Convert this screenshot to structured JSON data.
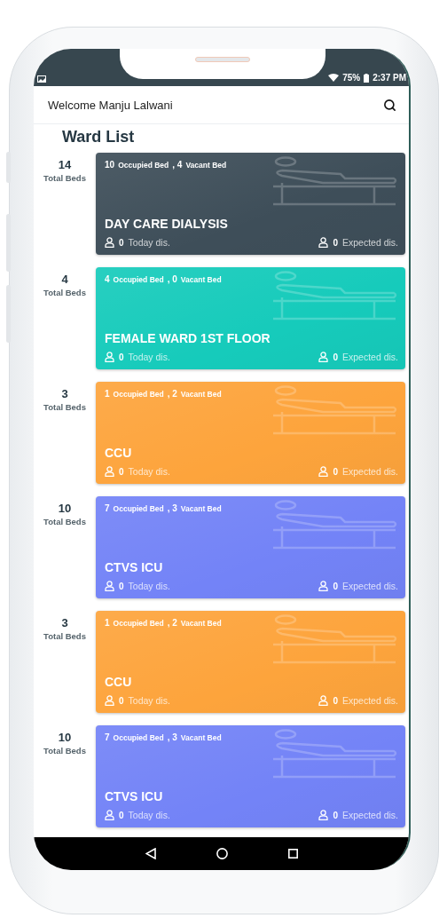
{
  "status_bar": {
    "battery": "75%",
    "time": "2:37 PM"
  },
  "header": {
    "title": "Welcome Manju Lalwani"
  },
  "page_title": "Ward List",
  "wards": [
    {
      "total": "14",
      "total_label": "Total Beds",
      "occupied": "10",
      "occupied_label": "Occupied Bed",
      "vacant": ", 4",
      "vacant_label": "Vacant Bed",
      "name": "DAY CARE DIALYSIS",
      "today": "0",
      "today_label": "Today dis.",
      "expected": "0",
      "expected_label": "Expected dis.",
      "color": "#3e4e59"
    },
    {
      "total": "4",
      "total_label": "Total Beds",
      "occupied": "4",
      "occupied_label": "Occupied Bed",
      "vacant": ", 0",
      "vacant_label": "Vacant Bed",
      "name": "FEMALE WARD 1ST FLOOR",
      "today": "0",
      "today_label": "Today dis.",
      "expected": "0",
      "expected_label": "Expected dis.",
      "color": "#16cbbb"
    },
    {
      "total": "3",
      "total_label": "Total Beds",
      "occupied": "1",
      "occupied_label": "Occupied Bed",
      "vacant": ", 2",
      "vacant_label": "Vacant Bed",
      "name": "CCU",
      "today": "0",
      "today_label": "Today dis.",
      "expected": "0",
      "expected_label": "Expected dis.",
      "color": "#fda43c"
    },
    {
      "total": "10",
      "total_label": "Total Beds",
      "occupied": "7",
      "occupied_label": "Occupied Bed",
      "vacant": ", 3",
      "vacant_label": "Vacant Bed",
      "name": "CTVS ICU",
      "today": "0",
      "today_label": "Today dis.",
      "expected": "0",
      "expected_label": "Expected dis.",
      "color": "#7383f7"
    },
    {
      "total": "3",
      "total_label": "Total Beds",
      "occupied": "1",
      "occupied_label": "Occupied Bed",
      "vacant": ", 2",
      "vacant_label": "Vacant Bed",
      "name": "CCU",
      "today": "0",
      "today_label": "Today dis.",
      "expected": "0",
      "expected_label": "Expected dis.",
      "color": "#fda43c"
    },
    {
      "total": "10",
      "total_label": "Total Beds",
      "occupied": "7",
      "occupied_label": "Occupied Bed",
      "vacant": ", 3",
      "vacant_label": "Vacant Bed",
      "name": "CTVS ICU",
      "today": "0",
      "today_label": "Today dis.",
      "expected": "0",
      "expected_label": "Expected dis.",
      "color": "#7383f7"
    }
  ]
}
